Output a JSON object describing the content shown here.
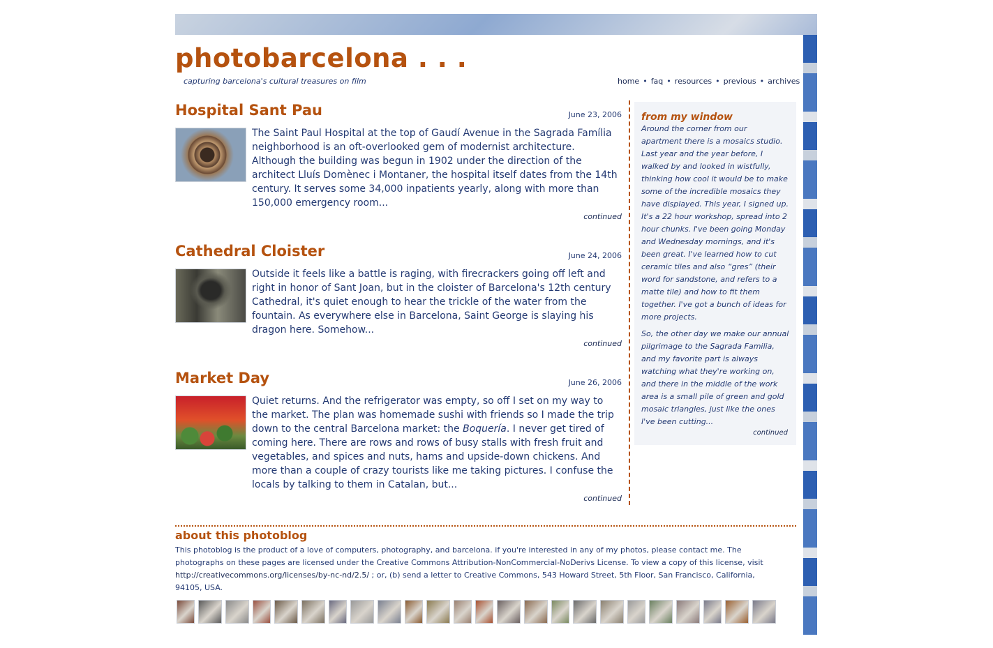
{
  "header": {
    "title": "photobarcelona . . .",
    "tagline": "capturing barcelona's cultural treasures on film"
  },
  "nav": {
    "items": [
      {
        "label": "home"
      },
      {
        "label": "faq"
      },
      {
        "label": "resources"
      },
      {
        "label": "previous"
      },
      {
        "label": "archives"
      }
    ],
    "separator": "•"
  },
  "posts": [
    {
      "title": "Hospital Sant Pau",
      "date": "June 23, 2006",
      "thumb_icon": "sculpture-photo",
      "body": "The Saint Paul Hospital at the top of Gaudí Avenue in the Sagrada Família neighborhood is an oft-overlooked gem of modernist architecture. Although the building was begun in 1902 under the direction of the architect Lluís Domènec i Montaner, the hospital itself dates from the 14th century. It serves some 34,000 inpatients yearly, along with more than 150,000 emergency room...",
      "continued": "continued"
    },
    {
      "title": "Cathedral Cloister",
      "date": "June 24, 2006",
      "thumb_icon": "statue-photo",
      "body": "Outside it feels like a battle is raging, with firecrackers going off left and right in honor of Sant Joan, but in the cloister of Barcelona's 12th century Cathedral, it's quiet enough to hear the trickle of the water from the fountain. As everywhere else in Barcelona, Saint George is slaying his dragon here. Somehow...",
      "continued": "continued"
    },
    {
      "title": "Market Day",
      "date": "June 26, 2006",
      "thumb_icon": "market-fruit-photo",
      "body_before": "Quiet returns. And the refrigerator was empty, so off I set on my way to the market. The plan was homemade sushi with friends so I made the trip down to the central Barcelona market: the ",
      "body_em": "Boquería",
      "body_after": ". I never get tired of coming here. There are rows and rows of busy stalls with fresh fruit and vegetables, and spices and nuts, hams and upside-down chickens. And more than a couple of crazy tourists like me taking pictures. I confuse the locals by talking to them in Catalan, but...",
      "continued": "continued"
    }
  ],
  "sidebar": {
    "title": "from my window",
    "para1": "Around the corner from our apartment there is a mosaics studio. Last year and the year before, I walked by and looked in wistfully, thinking how cool it would be to make some of the incredible mosaics they have displayed. This year, I signed up. It's a 22 hour workshop, spread into 2 hour chunks. I've been going Monday and Wednesday mornings, and it's been great. I've learned how to cut ceramic tiles and also “gres” (their word for sandstone, and refers to a matte tile) and how to fit them together. I've got a bunch of ideas for more projects.",
    "para2": "So, the other day we make our annual pilgrimage to the Sagrada Familia, and my favorite part is always watching what they're working on, and there in the middle of the work area is a small pile of green and gold mosaic triangles, just like the ones I've been cutting...",
    "continued": "continued"
  },
  "about": {
    "title": "about this photoblog",
    "text1": "This photoblog is the product of a love of computers, photography, and barcelona. if you're interested in any of my photos, please contact me. The photographs on these pages are licensed under the Creative Commons Attribution-NonCommercial-NoDerivs License. To view a copy of this license, visit ",
    "link": "http://creativecommons.org/licenses/by-nc-nd/2.5/",
    "text2": " ; or, (b) send a letter to Creative Commons, 543 Howard Street, 5th Floor, San Francisco, California, 94105, USA."
  },
  "thumbnails": [
    "#7a4a3a",
    "#5a5a5a",
    "#8a8a8a",
    "#9b5040",
    "#6b5a48",
    "#7b7060",
    "#6a6a80",
    "#9a9a9a",
    "#7a8090",
    "#8a5a30",
    "#8a7a50",
    "#9a8070",
    "#a85030",
    "#6a6060",
    "#8a6a50",
    "#7a8a60",
    "#6a6a6a",
    "#8a8070",
    "#9a9a9a",
    "#6a8060",
    "#8a7a7a",
    "#7a7a8a",
    "#9a6030",
    "#7a7a8a"
  ],
  "colors": {
    "accent": "#b5520f",
    "text": "#243a73",
    "sidebar_bg": "#f2f4f8"
  }
}
